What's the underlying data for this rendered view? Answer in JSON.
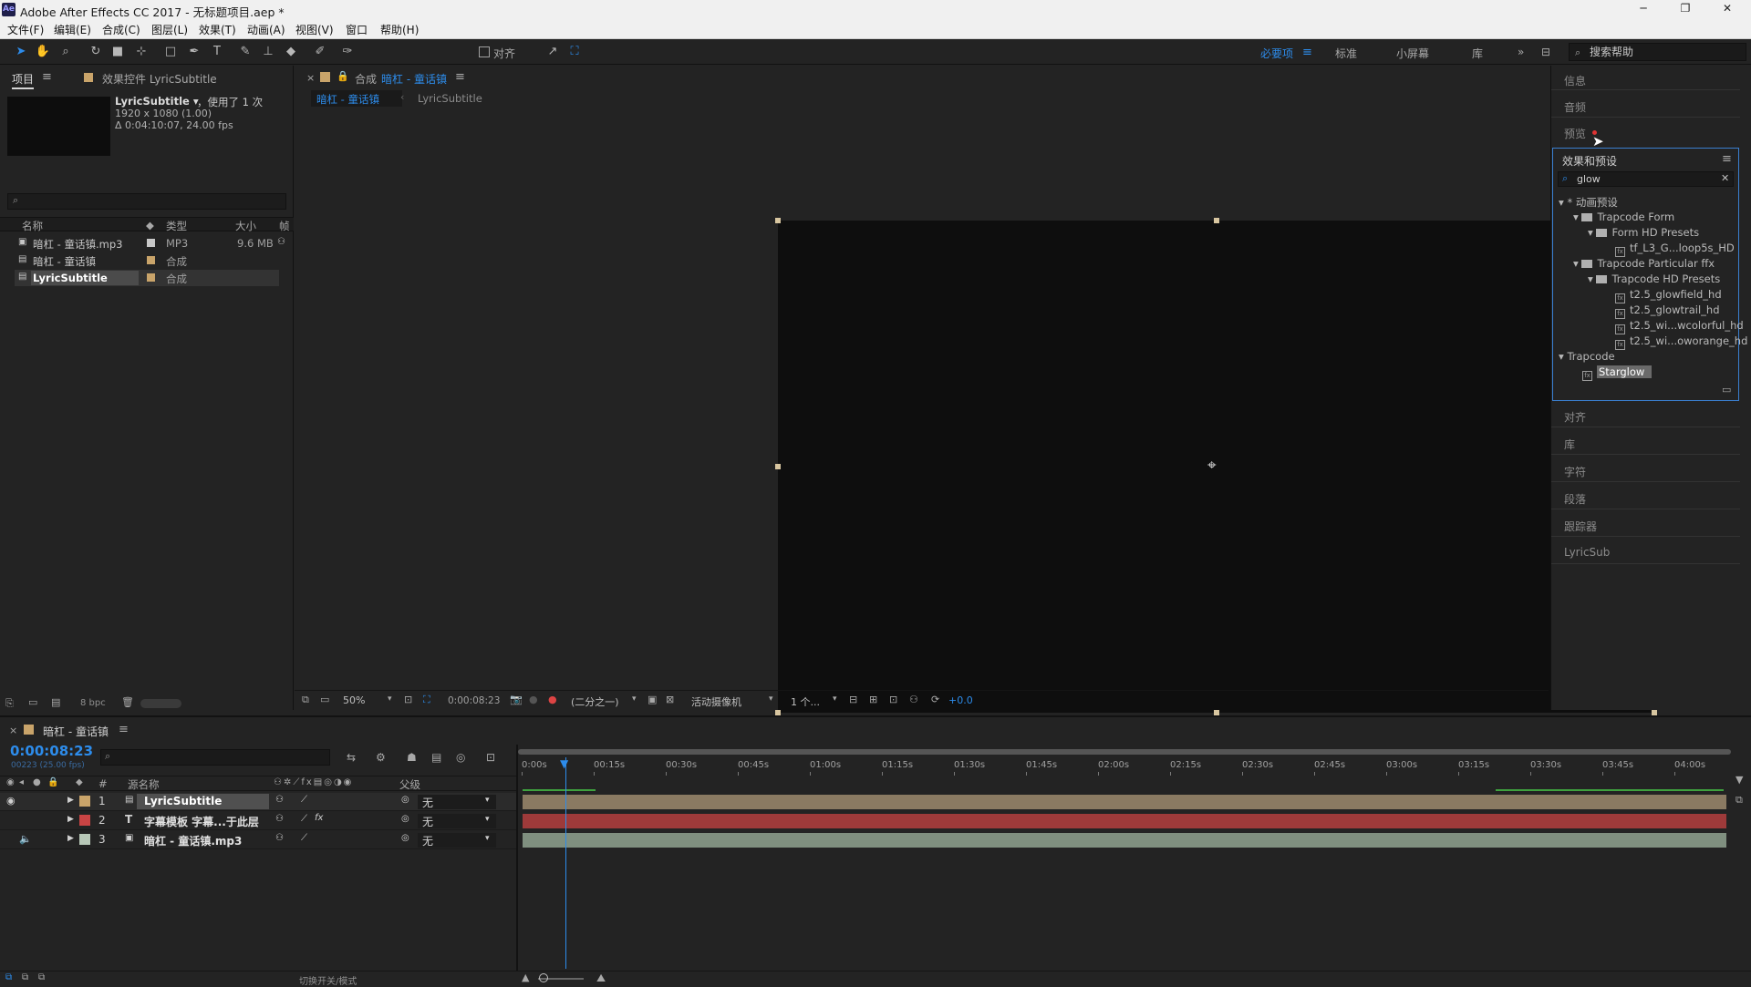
{
  "window": {
    "app_logo": "Ae",
    "title": "Adobe After Effects CC 2017 - 无标题项目.aep *"
  },
  "menu": [
    "文件(F)",
    "编辑(E)",
    "合成(C)",
    "图层(L)",
    "效果(T)",
    "动画(A)",
    "视图(V)",
    "窗口",
    "帮助(H)"
  ],
  "toolbar": {
    "align_label": "对齐",
    "workspaces": [
      "必要项",
      "标准",
      "小屏幕",
      "库"
    ],
    "active_workspace": "必要项",
    "help_placeholder": "搜索帮助"
  },
  "project": {
    "tab_label": "项目",
    "effect_controls_tab": "效果控件 LyricSubtitle",
    "selected_name": "LyricSubtitle ▾",
    "usage": "，使用了 1 次",
    "dims": "1920 x 1080 (1.00)",
    "duration": "Δ 0:04:10:07, 24.00 fps",
    "columns": {
      "name": "名称",
      "type": "类型",
      "size": "大小",
      "frame": "帧"
    },
    "items": [
      {
        "name": "暗杠 - 童话镇.mp3",
        "type": "MP3",
        "size": "9.6 MB",
        "color": "#c8c8c8"
      },
      {
        "name": "暗杠 - 童话镇",
        "type": "合成",
        "size": "",
        "color": "#c9a46a"
      },
      {
        "name": "LyricSubtitle",
        "type": "合成",
        "size": "",
        "color": "#c9a46a"
      }
    ],
    "bpc": "8 bpc"
  },
  "viewer": {
    "comp_label": "合成",
    "comp_name": "暗杠 - 童话镇",
    "breadcrumbs": [
      "暗杠 - 童话镇",
      "LyricSubtitle"
    ],
    "zoom": "50%",
    "timecode": "0:00:08:23",
    "resolution": "(二分之一)",
    "camera": "活动摄像机",
    "views": "1 个...",
    "exposure": "+0.0"
  },
  "right_panels": {
    "top": [
      "信息",
      "音频",
      "预览"
    ],
    "effects_title": "效果和预设",
    "effects_search": "glow",
    "tree": [
      {
        "label": "* 动画预设",
        "kind": "root"
      },
      {
        "label": "Trapcode Form",
        "kind": "folder"
      },
      {
        "label": "Form HD Presets",
        "kind": "folder"
      },
      {
        "label": "tf_L3_G...loop5s_HD",
        "kind": "fx"
      },
      {
        "label": "Trapcode Particular ffx",
        "kind": "folder"
      },
      {
        "label": "Trapcode HD Presets",
        "kind": "folder"
      },
      {
        "label": "t2.5_glowfield_hd",
        "kind": "fx"
      },
      {
        "label": "t2.5_glowtrail_hd",
        "kind": "fx"
      },
      {
        "label": "t2.5_wi...wcolorful_hd",
        "kind": "fx"
      },
      {
        "label": "t2.5_wi...oworange_hd",
        "kind": "fx"
      },
      {
        "label": "Trapcode",
        "kind": "root"
      },
      {
        "label": "Starglow",
        "kind": "fx"
      }
    ],
    "bottom": [
      "对齐",
      "库",
      "字符",
      "段落",
      "跟踪器",
      "LyricSub"
    ]
  },
  "timeline": {
    "tab_label": "暗杠 - 童话镇",
    "timecode": "0:00:08:23",
    "frame_info": "00223 (25.00 fps)",
    "col_source": "源名称",
    "col_parent": "父级",
    "ruler": [
      "0:00s",
      "00:15s",
      "00:30s",
      "00:45s",
      "01:00s",
      "01:15s",
      "01:30s",
      "01:45s",
      "02:00s",
      "02:15s",
      "02:30s",
      "02:45s",
      "03:00s",
      "03:15s",
      "03:30s",
      "03:45s",
      "04:00s"
    ],
    "layers": [
      {
        "num": "1",
        "name": "LyricSubtitle",
        "parent": "无",
        "color": "#c9a46a",
        "track_color": "#8a7a62"
      },
      {
        "num": "2",
        "name": "字幕模板 字幕...于此层",
        "parent": "无",
        "color": "#c94444",
        "track_color": "#9e3a3a"
      },
      {
        "num": "3",
        "name": "暗杠 - 童话镇.mp3",
        "parent": "无",
        "color": "#b8c8b8",
        "track_color": "#7f8f7f"
      }
    ],
    "toggle_label": "切换开关/模式"
  }
}
